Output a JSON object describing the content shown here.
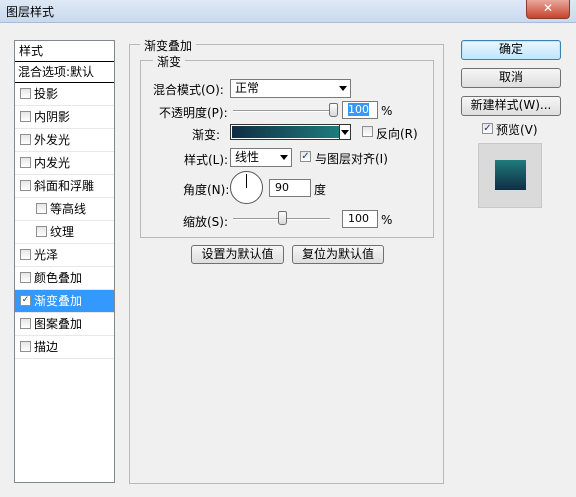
{
  "window": {
    "title": "图层样式",
    "close_glyph": "✕"
  },
  "style_list": {
    "header": "样式",
    "blend_options": "混合选项:默认",
    "items": [
      {
        "label": "投影",
        "checked": false,
        "sub": false,
        "selected": false
      },
      {
        "label": "内阴影",
        "checked": false,
        "sub": false,
        "selected": false
      },
      {
        "label": "外发光",
        "checked": false,
        "sub": false,
        "selected": false
      },
      {
        "label": "内发光",
        "checked": false,
        "sub": false,
        "selected": false
      },
      {
        "label": "斜面和浮雕",
        "checked": false,
        "sub": false,
        "selected": false
      },
      {
        "label": "等高线",
        "checked": false,
        "sub": true,
        "selected": false
      },
      {
        "label": "纹理",
        "checked": false,
        "sub": true,
        "selected": false
      },
      {
        "label": "光泽",
        "checked": false,
        "sub": false,
        "selected": false
      },
      {
        "label": "颜色叠加",
        "checked": false,
        "sub": false,
        "selected": false
      },
      {
        "label": "渐变叠加",
        "checked": true,
        "sub": false,
        "selected": true
      },
      {
        "label": "图案叠加",
        "checked": false,
        "sub": false,
        "selected": false
      },
      {
        "label": "描边",
        "checked": false,
        "sub": false,
        "selected": false
      }
    ]
  },
  "gradient_overlay": {
    "group_title": "渐变叠加",
    "subgroup_title": "渐变",
    "blend_mode_label": "混合模式(O):",
    "blend_mode_value": "正常",
    "opacity_label": "不透明度(P):",
    "opacity_value": "100",
    "opacity_fraction": 1.0,
    "percent": "%",
    "gradient_label": "渐变:",
    "gradient_colors": [
      "#0f2d44",
      "#1e7b7c"
    ],
    "reverse_label": "反向(R)",
    "reverse_checked": false,
    "style_label": "样式(L):",
    "style_value": "线性",
    "align_label": "与图层对齐(I)",
    "align_checked": true,
    "angle_label": "角度(N):",
    "angle_value": "90",
    "angle_unit": "度",
    "scale_label": "缩放(S):",
    "scale_value": "100",
    "scale_fraction": 0.5,
    "make_default": "设置为默认值",
    "reset_default": "复位为默认值"
  },
  "right_panel": {
    "ok": "确定",
    "cancel": "取消",
    "new_style": "新建样式(W)...",
    "preview_label": "预览(V)",
    "preview_checked": true
  },
  "colors": {
    "selection": "#3399ff",
    "preview_swatch": "#1e6f77"
  }
}
